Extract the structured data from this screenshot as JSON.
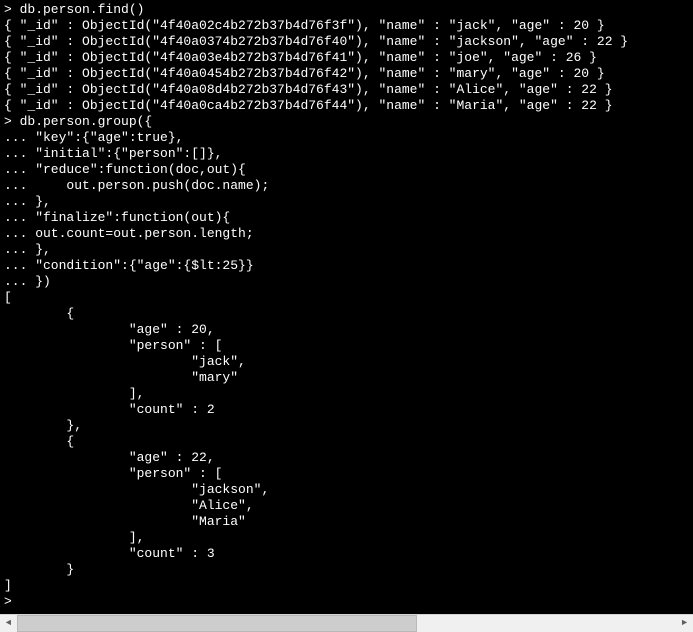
{
  "terminal": {
    "lines": [
      "> db.person.find()",
      "{ \"_id\" : ObjectId(\"4f40a02c4b272b37b4d76f3f\"), \"name\" : \"jack\", \"age\" : 20 }",
      "{ \"_id\" : ObjectId(\"4f40a0374b272b37b4d76f40\"), \"name\" : \"jackson\", \"age\" : 22 }",
      "{ \"_id\" : ObjectId(\"4f40a03e4b272b37b4d76f41\"), \"name\" : \"joe\", \"age\" : 26 }",
      "{ \"_id\" : ObjectId(\"4f40a0454b272b37b4d76f42\"), \"name\" : \"mary\", \"age\" : 20 }",
      "{ \"_id\" : ObjectId(\"4f40a08d4b272b37b4d76f43\"), \"name\" : \"Alice\", \"age\" : 22 }",
      "{ \"_id\" : ObjectId(\"4f40a0ca4b272b37b4d76f44\"), \"name\" : \"Maria\", \"age\" : 22 }",
      "> db.person.group({",
      "... \"key\":{\"age\":true},",
      "... \"initial\":{\"person\":[]},",
      "... \"reduce\":function(doc,out){",
      "...     out.person.push(doc.name);",
      "... },",
      "... \"finalize\":function(out){",
      "... out.count=out.person.length;",
      "... },",
      "... \"condition\":{\"age\":{$lt:25}}",
      "... })",
      "[",
      "        {",
      "                \"age\" : 20,",
      "                \"person\" : [",
      "                        \"jack\",",
      "                        \"mary\"",
      "                ],",
      "                \"count\" : 2",
      "        },",
      "        {",
      "                \"age\" : 22,",
      "                \"person\" : [",
      "                        \"jackson\",",
      "                        \"Alice\",",
      "                        \"Maria\"",
      "                ],",
      "                \"count\" : 3",
      "        }",
      "]",
      ">"
    ]
  },
  "scrollbar": {
    "left_arrow": "◄",
    "right_arrow": "►"
  }
}
